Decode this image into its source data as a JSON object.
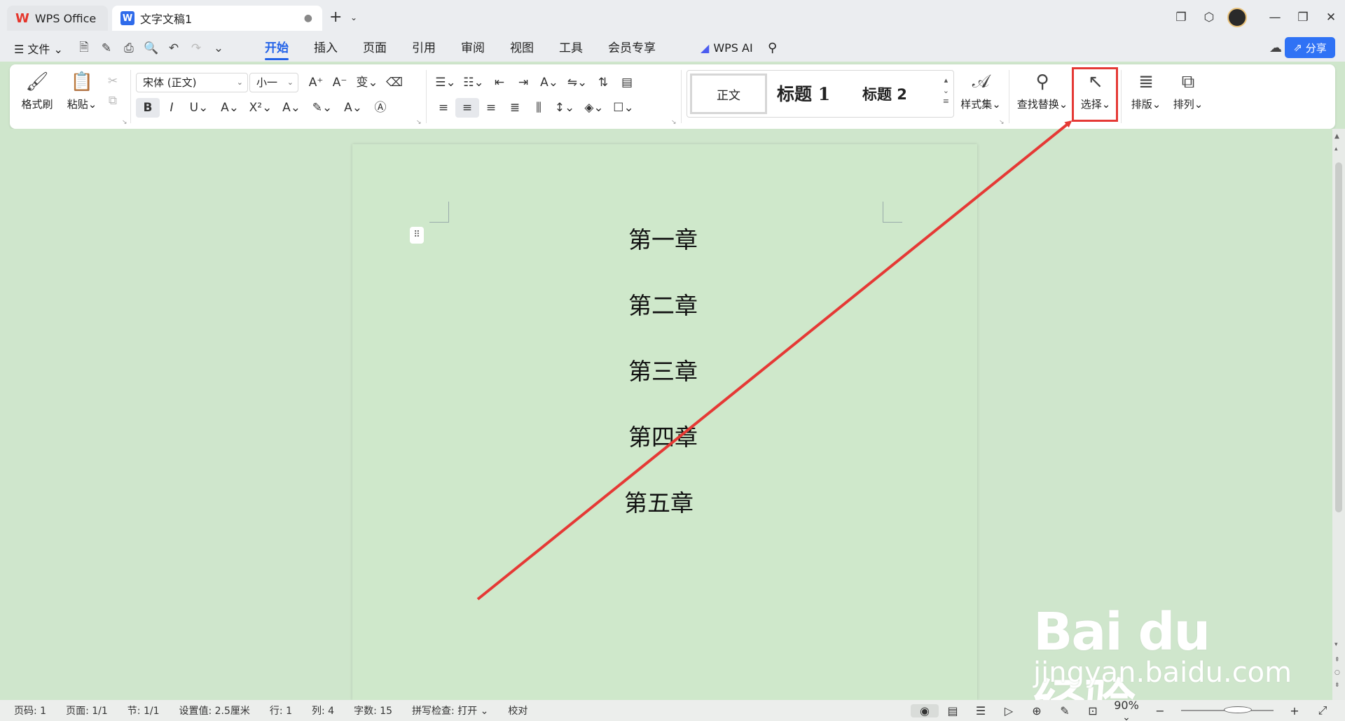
{
  "titlebar": {
    "home_tab": "WPS Office",
    "home_logo": "W",
    "doc_tab": "文字文稿1",
    "doc_logo": "W",
    "new_tab": "+",
    "icons": [
      "restore-window-icon",
      "cube-icon",
      "avatar",
      "minimize-icon",
      "maximize-icon",
      "close-icon"
    ]
  },
  "menubar": {
    "file_menu": "☰ 文件 ⌄",
    "quick_access": [
      "save-icon",
      "save-as-icon",
      "print-icon",
      "print-preview-icon",
      "undo-icon",
      "redo-icon",
      "more-icon"
    ],
    "tabs": [
      "开始",
      "插入",
      "页面",
      "引用",
      "审阅",
      "视图",
      "工具",
      "会员专享"
    ],
    "active_tab": "开始",
    "wps_ai": "WPS AI",
    "share": "分享"
  },
  "ribbon": {
    "format_painter": "格式刷",
    "paste": "粘贴",
    "font_name": "宋体 (正文)",
    "font_size": "小一",
    "styles": {
      "normal": "正文",
      "heading1": "标题 1",
      "heading2": "标题 2"
    },
    "style_set": "样式集",
    "find_replace": "查找替换",
    "select": "选择",
    "layout": "排版",
    "arrange": "排列"
  },
  "document": {
    "chapters": [
      "第一章",
      "第二章",
      "第三章",
      "第四章",
      "第五章"
    ]
  },
  "watermark": {
    "main": "Bai du 经验",
    "sub": "jingyan.baidu.com"
  },
  "statusbar": {
    "page_code": "页码: 1",
    "pages": "页面: 1/1",
    "section": "节: 1/1",
    "setting": "设置值: 2.5厘米",
    "row": "行: 1",
    "col": "列: 4",
    "word_count": "字数: 15",
    "spell_check": "拼写检查: 打开 ⌄",
    "proofread": "校对",
    "zoom": "90%",
    "zoom_level": 0.5
  },
  "colors": {
    "accent": "#2262e8",
    "annotation": "#e53935",
    "page_bg": "#cfe8cb"
  }
}
